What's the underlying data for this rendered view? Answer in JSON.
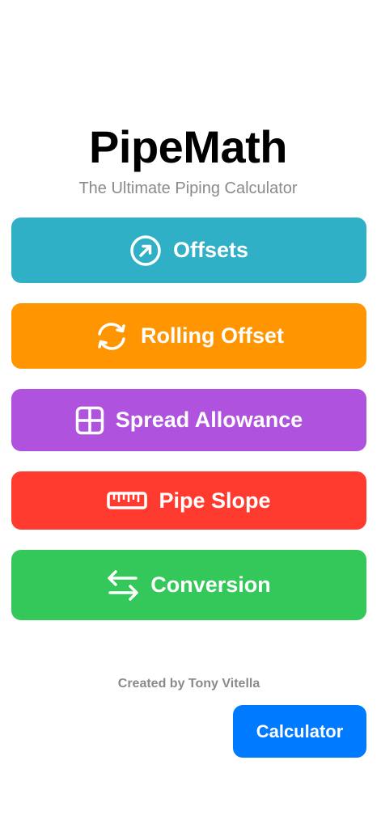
{
  "app": {
    "title": "PipeMath",
    "subtitle": "The Ultimate Piping Calculator"
  },
  "menu": [
    {
      "label": "Offsets",
      "icon": "arrow-up-right-circle-icon",
      "color": "#30b0c7"
    },
    {
      "label": "Rolling Offset",
      "icon": "rotate-arrows-icon",
      "color": "#ff9500"
    },
    {
      "label": "Spread Allowance",
      "icon": "grid-icon",
      "color": "#af52de"
    },
    {
      "label": "Pipe Slope",
      "icon": "ruler-icon",
      "color": "#ff3b30"
    },
    {
      "label": "Conversion",
      "icon": "swap-arrows-icon",
      "color": "#34c759"
    }
  ],
  "footer": {
    "credit": "Created by Tony Vitella",
    "calculator_label": "Calculator",
    "calculator_color": "#007aff"
  }
}
